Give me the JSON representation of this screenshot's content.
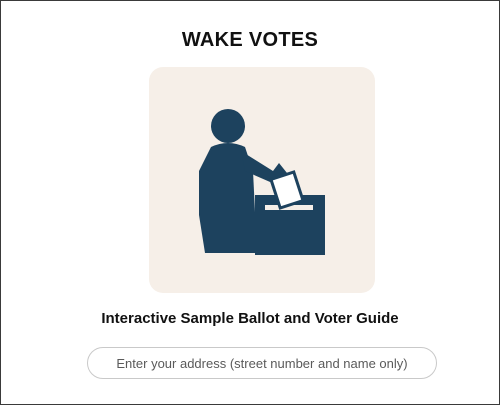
{
  "page": {
    "title": "WAKE VOTES",
    "subtitle": "Interactive Sample Ballot and Voter Guide"
  },
  "hero": {
    "icon": "person-voting-ballot-box-icon",
    "colors": {
      "background": "#f6efe8",
      "figure": "#1d425e",
      "ballot": "#ffffff"
    }
  },
  "address_search": {
    "value": "",
    "placeholder": "Enter your address (street number and name only)"
  }
}
